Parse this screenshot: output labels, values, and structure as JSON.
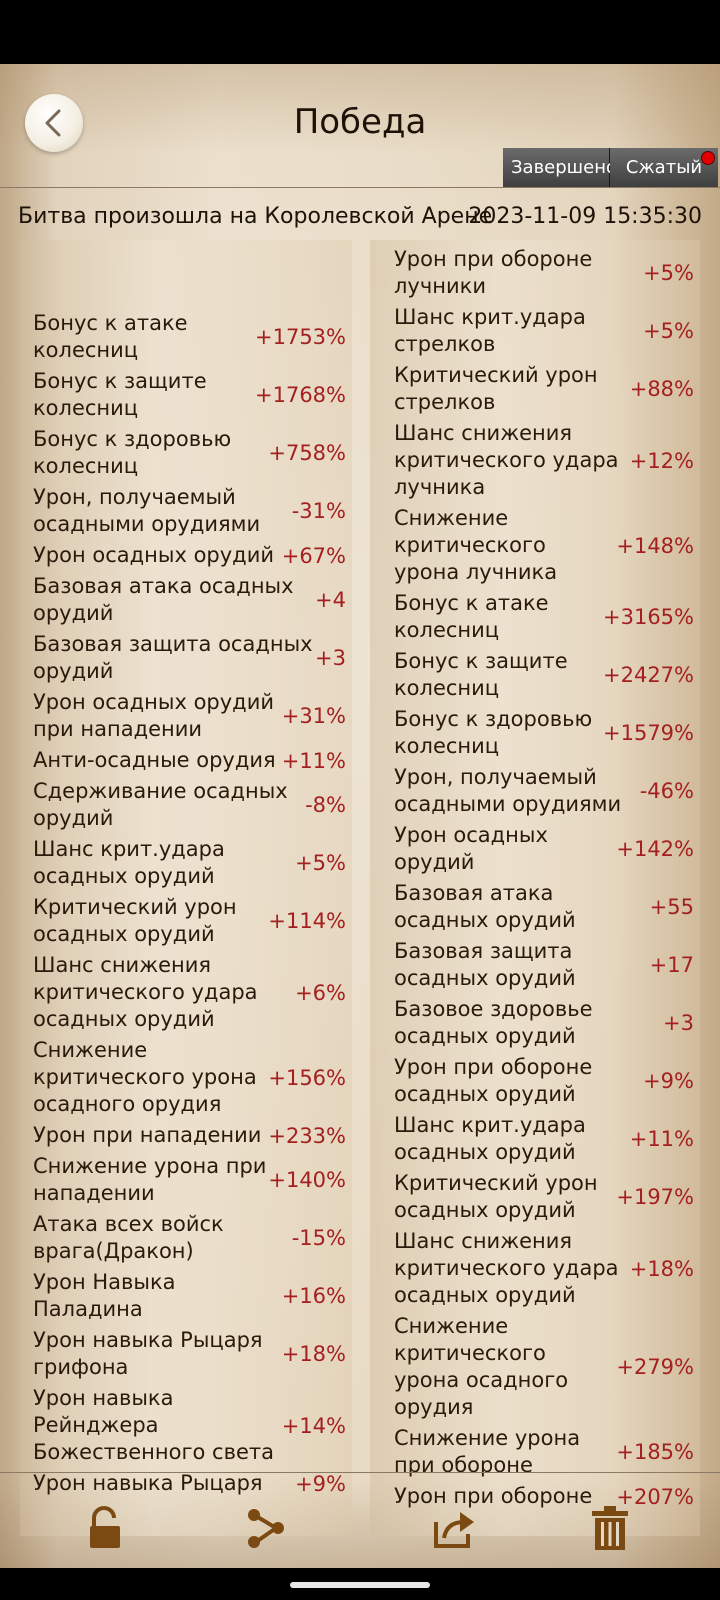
{
  "header": {
    "title": "Победа",
    "toggle_done": "Завершено",
    "toggle_compact": "Сжатый"
  },
  "battle": {
    "location": "Битва произошла на Королевской Арене",
    "time": "2023-11-09  15:35:30"
  },
  "left_stats": [
    {
      "label": "Бонус к атаке колесниц",
      "value": "+1753%"
    },
    {
      "label": "Бонус к защите колесниц",
      "value": "+1768%"
    },
    {
      "label": "Бонус к здоровью колесниц",
      "value": "+758%"
    },
    {
      "label": "Урон, получаемый осадными орудиями",
      "value": "-31%"
    },
    {
      "label": "Урон осадных орудий",
      "value": "+67%"
    },
    {
      "label": "Базовая атака осадных орудий",
      "value": "+4"
    },
    {
      "label": "Базовая защита осадных орудий",
      "value": "+3"
    },
    {
      "label": "Урон осадных орудий при нападении",
      "value": "+31%"
    },
    {
      "label": "Анти-осадные орудия",
      "value": "+11%"
    },
    {
      "label": "Сдерживание осадных орудий",
      "value": "-8%"
    },
    {
      "label": "Шанс крит.удара осадных орудий",
      "value": "+5%"
    },
    {
      "label": "Критический урон осадных орудий",
      "value": "+114%"
    },
    {
      "label": "Шанс снижения критического удара осадных орудий",
      "value": "+6%"
    },
    {
      "label": "Снижение критического урона осадного орудия",
      "value": "+156%"
    },
    {
      "label": "Урон при нападении",
      "value": "+233%"
    },
    {
      "label": "Снижение урона при нападении",
      "value": "+140%"
    },
    {
      "label": "Атака всех войск врага(Дракон)",
      "value": "-15%"
    },
    {
      "label": "Урон Навыка Паладина",
      "value": "+16%"
    },
    {
      "label": "Урон навыка Рыцаря грифона",
      "value": "+18%"
    },
    {
      "label": "Урон навыка Рейнджера Божественного света",
      "value": "+14%"
    },
    {
      "label": "Урон навыка Рыцаря",
      "value": "+9%"
    }
  ],
  "right_stats": [
    {
      "label": "Урон при обороне лучники",
      "value": "+5%"
    },
    {
      "label": "Шанс крит.удара стрелков",
      "value": "+5%"
    },
    {
      "label": "Критический урон стрелков",
      "value": "+88%"
    },
    {
      "label": "Шанс снижения критического удара лучника",
      "value": "+12%"
    },
    {
      "label": "Снижение критического урона лучника",
      "value": "+148%"
    },
    {
      "label": "Бонус к атаке колесниц",
      "value": "+3165%"
    },
    {
      "label": "Бонус к защите колесниц",
      "value": "+2427%"
    },
    {
      "label": "Бонус к здоровью колесниц",
      "value": "+1579%"
    },
    {
      "label": "Урон, получаемый осадными орудиями",
      "value": "-46%"
    },
    {
      "label": "Урон осадных орудий",
      "value": "+142%"
    },
    {
      "label": "Базовая атака осадных орудий",
      "value": "+55"
    },
    {
      "label": "Базовая защита осадных орудий",
      "value": "+17"
    },
    {
      "label": "Базовое здоровье осадных орудий",
      "value": "+3"
    },
    {
      "label": "Урон при обороне осадных орудий",
      "value": "+9%"
    },
    {
      "label": "Шанс крит.удара осадных орудий",
      "value": "+11%"
    },
    {
      "label": "Критический урон осадных орудий",
      "value": "+197%"
    },
    {
      "label": "Шанс снижения критического удара осадных орудий",
      "value": "+18%"
    },
    {
      "label": "Снижение критического урона осадного орудия",
      "value": "+279%"
    },
    {
      "label": "Снижение урона при обороне",
      "value": "+185%"
    },
    {
      "label": "Урон при обороне",
      "value": "+207%"
    }
  ],
  "toolbar": {
    "icons": [
      "lock-icon",
      "share-icon",
      "export-icon",
      "trash-icon"
    ]
  },
  "colors": {
    "value_red": "#a42020",
    "text_dark": "#2a1a0c",
    "toggle_bg": "#4a4a4a",
    "badge_red": "#e00000"
  }
}
